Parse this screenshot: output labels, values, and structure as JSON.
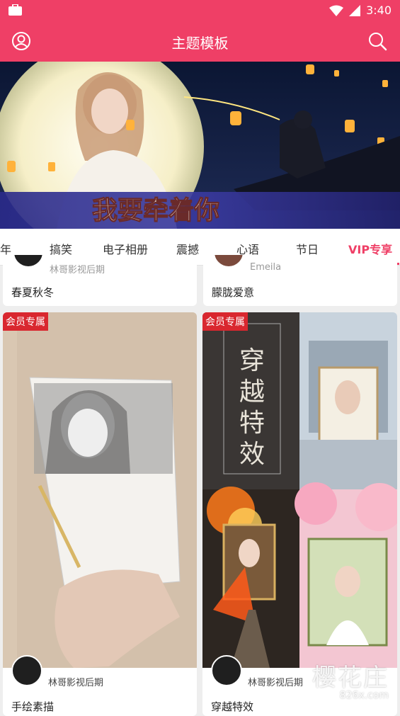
{
  "status_bar": {
    "time": "3:40"
  },
  "app_bar": {
    "title": "主题模板"
  },
  "banner": {
    "caption": "我要牵着你"
  },
  "tabs": [
    "年",
    "搞笑",
    "电子相册",
    "震撼",
    "心语",
    "节日",
    "VIP专享"
  ],
  "cards_top": [
    {
      "author": "林哥影视后期",
      "name": "春夏秋冬"
    },
    {
      "author": "Emeila",
      "name": "朦胧爱意"
    }
  ],
  "cards_main": [
    {
      "badge": "会员专属",
      "author": "林哥影视后期",
      "name": "手绘素描"
    },
    {
      "badge": "会员专属",
      "title_art": "穿越特效",
      "author": "林哥影视后期",
      "name": "穿越特效"
    }
  ],
  "watermark": {
    "text": "樱花庄",
    "site": "826x.com"
  },
  "colors": {
    "accent": "#ef3f66",
    "badge": "#d9272f"
  }
}
